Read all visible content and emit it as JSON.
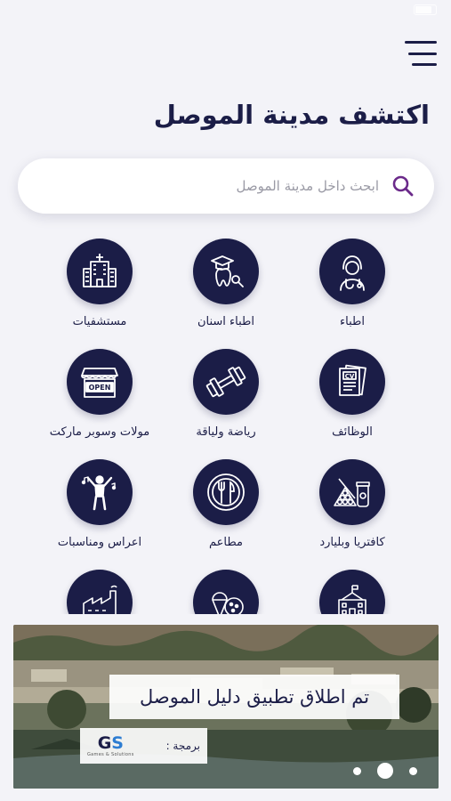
{
  "status": {
    "carrier": "",
    "time": "",
    "battery": ""
  },
  "header": {
    "title": "اكتشف مدينة الموصل"
  },
  "search": {
    "placeholder": "ابحث داخل مدينة الموصل",
    "value": ""
  },
  "categories": [
    {
      "label": "اطباء",
      "icon": "doctor-icon"
    },
    {
      "label": "اطباء اسنان",
      "icon": "dentist-icon"
    },
    {
      "label": "مستشفيات",
      "icon": "hospital-icon"
    },
    {
      "label": "الوظائف",
      "icon": "cv-icon"
    },
    {
      "label": "رياضة ولياقة",
      "icon": "dumbbell-icon"
    },
    {
      "label": "مولات وسوبر ماركت",
      "icon": "open-store-icon"
    },
    {
      "label": "كافتريا وبليارد",
      "icon": "billiard-coffee-icon"
    },
    {
      "label": "مطاعم",
      "icon": "plate-cutlery-icon"
    },
    {
      "label": "اعراس ومناسبات",
      "icon": "dancer-icon"
    },
    {
      "label": "",
      "icon": "school-icon"
    },
    {
      "label": "",
      "icon": "sweets-icon"
    },
    {
      "label": "",
      "icon": "factory-icon"
    }
  ],
  "banner": {
    "headline": "تم اطلاق تطبيق دليل الموصل",
    "credit_label": "برمجة :",
    "logo_mark_g": "G",
    "logo_mark_s": "S",
    "logo_sub": "Games & Solutions",
    "slides_total": 3,
    "active_slide": 2
  },
  "colors": {
    "primary": "#1b1d47",
    "background": "#f3f3f8",
    "search_icon": "#6b2a8a"
  }
}
